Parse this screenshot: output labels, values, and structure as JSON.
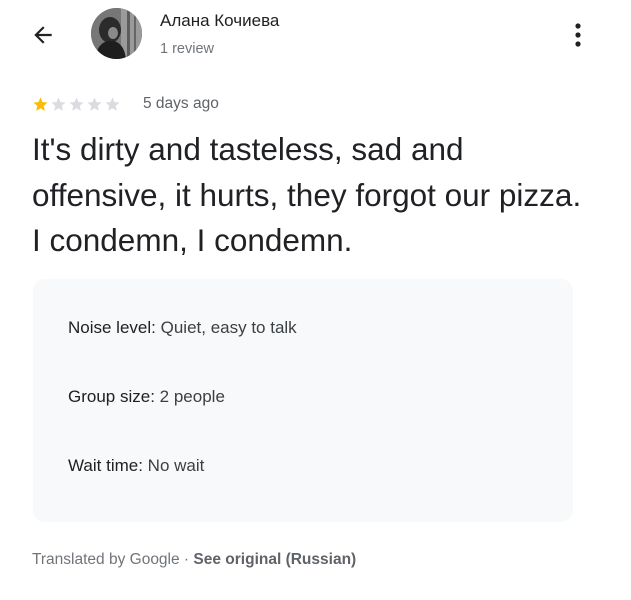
{
  "header": {
    "back_icon": "arrow-left-icon",
    "author_name": "Алана Кочиева",
    "review_count": "1 review",
    "more_icon": "more-vert-icon"
  },
  "review": {
    "rating": 1,
    "rating_max": 5,
    "star_filled_color": "#fbbc04",
    "star_empty_color": "#dadce0",
    "date": "5 days ago",
    "text": "It's dirty and tasteless, sad and offensive, it hurts, they forgot our pizza. I condemn, I condemn."
  },
  "attributes": [
    {
      "label": "Noise level:",
      "value": "Quiet, easy to talk"
    },
    {
      "label": "Group size:",
      "value": "2 people"
    },
    {
      "label": "Wait time:",
      "value": "No wait"
    }
  ],
  "translation": {
    "note": "Translated by Google · ",
    "link": "See original (Russian)"
  }
}
